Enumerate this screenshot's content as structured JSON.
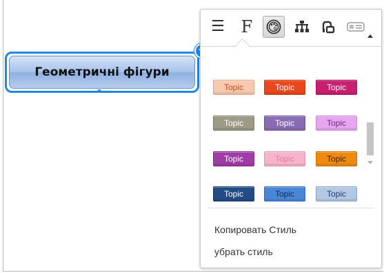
{
  "topic_node": {
    "label": "Геометричні фігури"
  },
  "toolbar": {
    "items": [
      {
        "name": "menu",
        "glyph": "☰",
        "active": false
      },
      {
        "name": "font",
        "glyph": "F",
        "active": false
      },
      {
        "name": "style",
        "glyph": "",
        "active": true
      },
      {
        "name": "structure",
        "glyph": "",
        "active": false
      },
      {
        "name": "link",
        "glyph": "",
        "active": false
      },
      {
        "name": "label",
        "glyph": "",
        "active": false
      }
    ]
  },
  "styles": [
    {
      "label": "Topic",
      "bg": "#f7c9b1",
      "border": "#e5a383",
      "color": "#d24a1e"
    },
    {
      "label": "Topic",
      "bg": "#e8481c",
      "border": "#c83a12",
      "color": "#ffffff"
    },
    {
      "label": "Topic",
      "bg": "#c82070",
      "border": "#a0165a",
      "color": "#ffffff"
    },
    {
      "label": "Topic",
      "bg": "#9c9c86",
      "border": "#7e7e6a",
      "color": "#ffffff"
    },
    {
      "label": "Topic",
      "bg": "#8a6cb4",
      "border": "#6c5096",
      "color": "#ffffff"
    },
    {
      "label": "Topic",
      "bg": "#e8a6f0",
      "border": "#c886d6",
      "color": "#6a2a84"
    },
    {
      "label": "Topic",
      "bg": "#a03ca6",
      "border": "#842a8c",
      "color": "#ffffff"
    },
    {
      "label": "Topic",
      "bg": "#f6b4cc",
      "border": "#de96b2",
      "color": "#e87aa0"
    },
    {
      "label": "Topic",
      "bg": "#ee8a10",
      "border": "#cc700a",
      "color": "#3a2200"
    },
    {
      "label": "Topic",
      "bg": "#234c86",
      "border": "#17386a",
      "color": "#ffffff"
    },
    {
      "label": "Topic",
      "bg": "#4a86d8",
      "border": "#3266b8",
      "color": "#0d2a5a"
    },
    {
      "label": "Topic",
      "bg": "#b4c8e6",
      "border": "#8aa2c8",
      "color": "#1e3c6e"
    }
  ],
  "menu": {
    "copy_style": "Копировать Стиль",
    "remove_style": "убрать стиль"
  }
}
